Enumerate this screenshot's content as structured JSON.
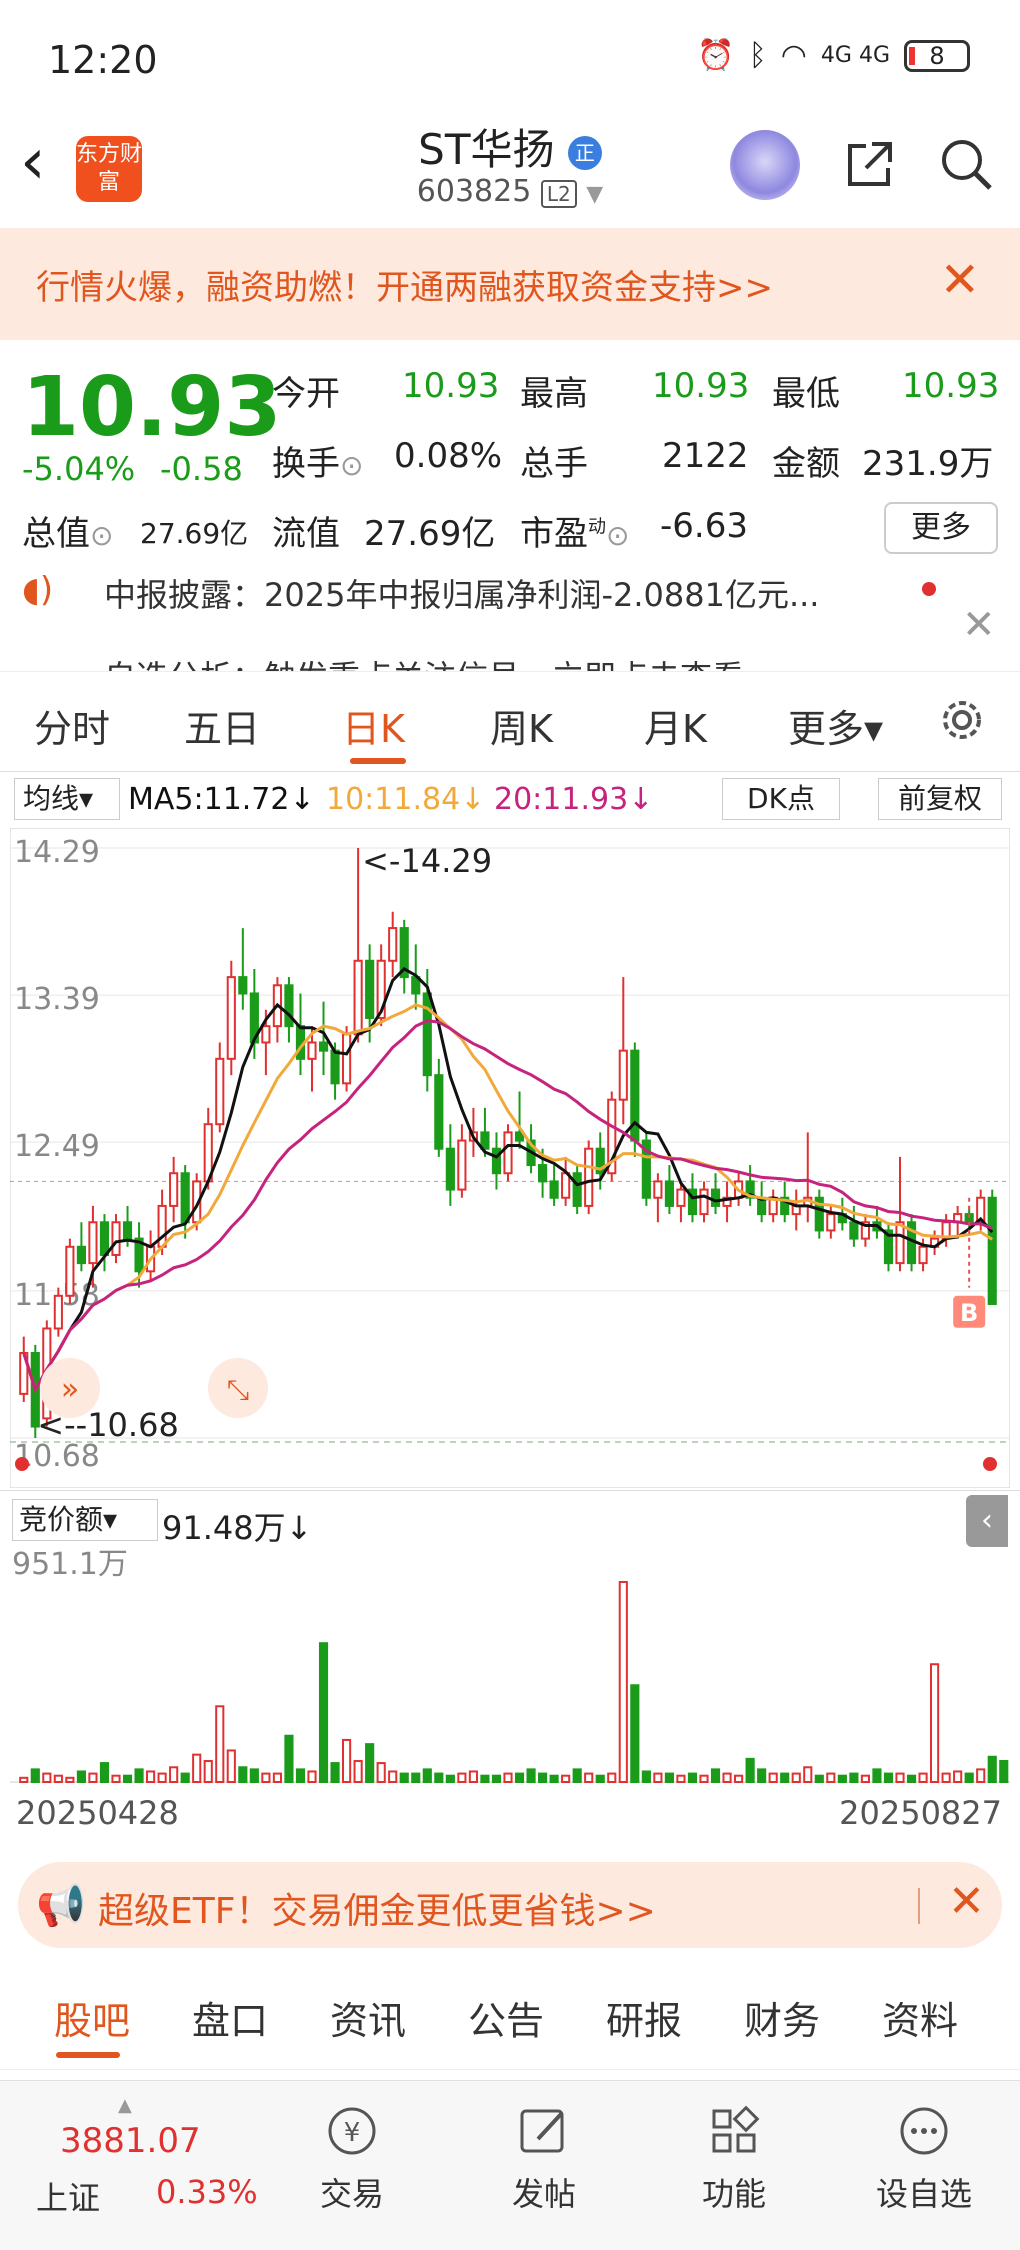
{
  "status_bar": {
    "time": "12:20",
    "signal": "4G 4G",
    "battery": "8"
  },
  "header": {
    "stock_name": "ST华扬",
    "name_tag": "正",
    "stock_code": "603825",
    "level": "L2",
    "logo_text": "东方财富"
  },
  "promo": {
    "text": "行情火爆，融资助燃！开通两融获取资金支持>>"
  },
  "quote": {
    "price": "10.93",
    "change_pct": "-5.04%",
    "change": "-0.58",
    "open_label": "今开",
    "open": "10.93",
    "high_label": "最高",
    "high": "10.93",
    "low_label": "最低",
    "low": "10.93",
    "turnover_label": "换手",
    "turnover": "0.08%",
    "volume_label": "总手",
    "volume": "2122",
    "amount_label": "金额",
    "amount": "231.9万",
    "mktcap_label": "总值",
    "mktcap": "27.69亿",
    "float_label": "流值",
    "float_cap": "27.69亿",
    "pe_label": "市盈",
    "pe_sup": "动",
    "pe": "-6.63",
    "more_label": "更多"
  },
  "news": {
    "line1": "中报披露：2025年中报归属净利润-2.0881亿元...",
    "line2": "自选分析：触发重点关注信号，立即点击查看"
  },
  "period_tabs": [
    "分时",
    "五日",
    "日K",
    "周K",
    "月K",
    "更多▾"
  ],
  "active_period": "日K",
  "ma_legend": {
    "selector": "均线▾",
    "ma5": "MA5:11.72↓",
    "ma10": "10:11.84↓",
    "ma20": "20:11.93↓",
    "dk": "DK点",
    "fq": "前复权"
  },
  "colors": {
    "up": "#e03030",
    "down": "#1a9b1a",
    "ma5": "#111111",
    "ma10": "#f2a93b",
    "ma20": "#c6237e",
    "accent": "#e0561e"
  },
  "chart_data": {
    "type": "candlestick",
    "title": "",
    "y_ticks": [
      "14.29",
      "13.39",
      "12.49",
      "11.58",
      "10.68"
    ],
    "ylim": [
      10.68,
      14.29
    ],
    "annotations": {
      "max": "<-14.29",
      "min": "<--10.68"
    },
    "buy_marker": "B",
    "candles": [
      [
        10.95,
        11.3,
        10.9,
        11.2
      ],
      [
        11.2,
        11.25,
        10.68,
        10.75
      ],
      [
        10.8,
        11.4,
        10.75,
        11.35
      ],
      [
        11.35,
        11.6,
        11.3,
        11.55
      ],
      [
        11.55,
        11.9,
        11.5,
        11.85
      ],
      [
        11.85,
        12.0,
        11.7,
        11.75
      ],
      [
        11.75,
        12.1,
        11.6,
        12.0
      ],
      [
        12.0,
        12.05,
        11.7,
        11.8
      ],
      [
        11.8,
        12.05,
        11.75,
        12.0
      ],
      [
        12.0,
        12.1,
        11.85,
        11.9
      ],
      [
        11.9,
        12.0,
        11.6,
        11.7
      ],
      [
        11.7,
        11.95,
        11.65,
        11.85
      ],
      [
        11.85,
        12.2,
        11.8,
        12.1
      ],
      [
        12.1,
        12.4,
        12.0,
        12.3
      ],
      [
        12.3,
        12.35,
        11.9,
        12.0
      ],
      [
        12.0,
        12.3,
        11.95,
        12.25
      ],
      [
        12.25,
        12.7,
        12.2,
        12.6
      ],
      [
        12.6,
        13.1,
        12.55,
        13.0
      ],
      [
        13.0,
        13.6,
        12.9,
        13.5
      ],
      [
        13.5,
        13.8,
        13.3,
        13.4
      ],
      [
        13.4,
        13.55,
        13.0,
        13.1
      ],
      [
        13.1,
        13.3,
        12.9,
        13.2
      ],
      [
        13.2,
        13.5,
        13.1,
        13.45
      ],
      [
        13.45,
        13.5,
        13.1,
        13.2
      ],
      [
        13.2,
        13.4,
        12.9,
        13.0
      ],
      [
        13.0,
        13.2,
        12.8,
        13.1
      ],
      [
        13.1,
        13.35,
        12.9,
        13.05
      ],
      [
        13.05,
        13.1,
        12.75,
        12.85
      ],
      [
        12.85,
        13.2,
        12.8,
        13.15
      ],
      [
        13.15,
        14.29,
        13.1,
        13.6
      ],
      [
        13.6,
        13.7,
        13.1,
        13.25
      ],
      [
        13.25,
        13.7,
        13.2,
        13.6
      ],
      [
        13.6,
        13.9,
        13.5,
        13.8
      ],
      [
        13.8,
        13.85,
        13.4,
        13.5
      ],
      [
        13.5,
        13.7,
        13.3,
        13.4
      ],
      [
        13.4,
        13.55,
        12.8,
        12.9
      ],
      [
        12.9,
        13.0,
        12.4,
        12.45
      ],
      [
        12.45,
        12.6,
        12.1,
        12.2
      ],
      [
        12.2,
        12.6,
        12.15,
        12.5
      ],
      [
        12.5,
        12.7,
        12.4,
        12.55
      ],
      [
        12.55,
        12.7,
        12.4,
        12.45
      ],
      [
        12.45,
        12.55,
        12.2,
        12.3
      ],
      [
        12.3,
        12.6,
        12.25,
        12.55
      ],
      [
        12.55,
        12.8,
        12.45,
        12.5
      ],
      [
        12.5,
        12.6,
        12.3,
        12.35
      ],
      [
        12.35,
        12.45,
        12.15,
        12.25
      ],
      [
        12.25,
        12.35,
        12.1,
        12.15
      ],
      [
        12.15,
        12.4,
        12.1,
        12.3
      ],
      [
        12.3,
        12.35,
        12.05,
        12.1
      ],
      [
        12.1,
        12.5,
        12.05,
        12.45
      ],
      [
        12.45,
        12.55,
        12.2,
        12.3
      ],
      [
        12.3,
        12.8,
        12.25,
        12.75
      ],
      [
        12.75,
        13.5,
        12.6,
        13.05
      ],
      [
        13.05,
        13.1,
        12.4,
        12.5
      ],
      [
        12.5,
        12.55,
        12.1,
        12.15
      ],
      [
        12.15,
        12.3,
        12.0,
        12.25
      ],
      [
        12.25,
        12.35,
        12.05,
        12.1
      ],
      [
        12.1,
        12.25,
        12.0,
        12.2
      ],
      [
        12.2,
        12.3,
        12.0,
        12.05
      ],
      [
        12.05,
        12.25,
        12.0,
        12.2
      ],
      [
        12.2,
        12.3,
        12.05,
        12.1
      ],
      [
        12.1,
        12.25,
        12.0,
        12.15
      ],
      [
        12.15,
        12.3,
        12.1,
        12.25
      ],
      [
        12.25,
        12.35,
        12.1,
        12.15
      ],
      [
        12.15,
        12.25,
        12.0,
        12.05
      ],
      [
        12.05,
        12.2,
        12.0,
        12.15
      ],
      [
        12.15,
        12.25,
        12.0,
        12.05
      ],
      [
        12.05,
        12.2,
        11.95,
        12.1
      ],
      [
        12.1,
        12.55,
        12.0,
        12.15
      ],
      [
        12.15,
        12.2,
        11.9,
        11.95
      ],
      [
        11.95,
        12.1,
        11.9,
        12.05
      ],
      [
        12.05,
        12.15,
        11.95,
        12.0
      ],
      [
        12.0,
        12.1,
        11.85,
        11.9
      ],
      [
        11.9,
        12.05,
        11.85,
        12.0
      ],
      [
        12.0,
        12.1,
        11.9,
        11.95
      ],
      [
        11.95,
        12.0,
        11.7,
        11.75
      ],
      [
        11.75,
        12.4,
        11.7,
        12.0
      ],
      [
        12.0,
        12.05,
        11.7,
        11.75
      ],
      [
        11.75,
        11.9,
        11.7,
        11.85
      ],
      [
        11.85,
        11.95,
        11.8,
        11.9
      ],
      [
        11.9,
        12.05,
        11.85,
        12.0
      ],
      [
        12.0,
        12.1,
        11.9,
        12.05
      ],
      [
        12.05,
        12.1,
        11.95,
        12.0
      ],
      [
        12.0,
        12.2,
        11.95,
        12.15
      ],
      [
        12.15,
        12.2,
        11.5,
        11.5
      ]
    ],
    "volume_label": "竞价额",
    "volume_value": "91.48万↓",
    "volume_max_label": "951.1万",
    "volumes": [
      20,
      60,
      40,
      30,
      20,
      50,
      40,
      90,
      30,
      30,
      60,
      50,
      40,
      70,
      40,
      130,
      100,
      360,
      150,
      70,
      60,
      40,
      40,
      220,
      60,
      50,
      660,
      90,
      200,
      100,
      180,
      90,
      50,
      40,
      40,
      60,
      40,
      30,
      40,
      50,
      30,
      30,
      40,
      40,
      60,
      40,
      30,
      30,
      60,
      40,
      30,
      40,
      951,
      460,
      50,
      40,
      40,
      30,
      40,
      30,
      60,
      40,
      30,
      110,
      60,
      40,
      40,
      40,
      70,
      30,
      40,
      30,
      40,
      30,
      60,
      40,
      40,
      30,
      40,
      560,
      40,
      50,
      40,
      60,
      120,
      100
    ],
    "x_start": "20250428",
    "x_end": "20250827"
  },
  "etf": {
    "text": "超级ETF！交易佣金更低更省钱>>"
  },
  "bottom_tabs": [
    "股吧",
    "盘口",
    "资讯",
    "公告",
    "研报",
    "财务",
    "资料"
  ],
  "footer": {
    "index_value": "3881.07",
    "index_name": "上证",
    "index_pct": "0.33%",
    "items": [
      "交易",
      "发帖",
      "功能",
      "设自选"
    ]
  }
}
